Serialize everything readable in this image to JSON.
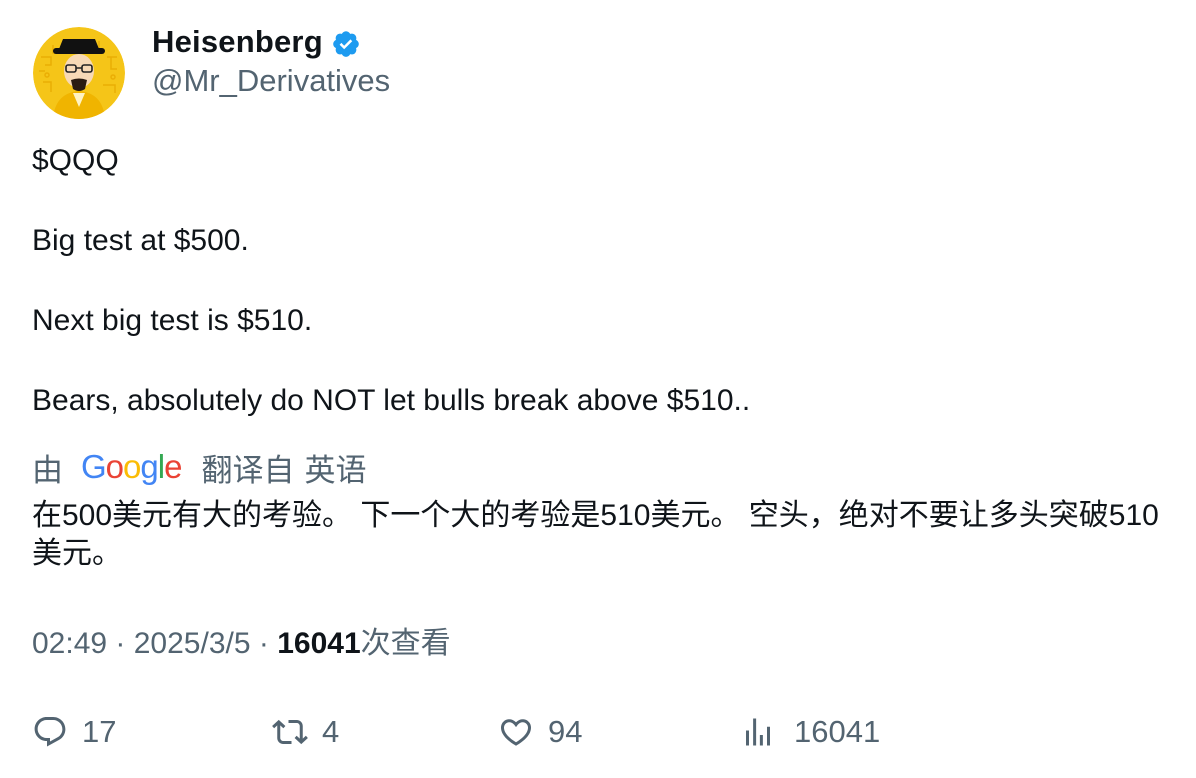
{
  "author": {
    "display_name": "Heisenberg",
    "handle": "@Mr_Derivatives",
    "verified_color": "#1d9bf0"
  },
  "tweet": {
    "lines": [
      "$QQQ",
      "Big test at $500.",
      "Next big test is $510.",
      "Bears, absolutely do NOT let bulls break above $510.."
    ]
  },
  "translation": {
    "by": "由",
    "provider": "Google",
    "from_label": "翻译自",
    "language": "英语",
    "text": "在500美元有大的考验。 下一个大的考验是510美元。 空头，绝对不要让多头突破510美元。"
  },
  "meta": {
    "time": "02:49",
    "separator1": " · ",
    "date": "2025/3/5",
    "separator2": " · ",
    "views_count": "16041",
    "views_label": "次查看"
  },
  "actions": {
    "replies": "17",
    "retweets": "4",
    "likes": "94",
    "views": "16041"
  },
  "colors": {
    "text": "#0f1419",
    "secondary": "#536471",
    "avatar_bg": "#f5c518"
  }
}
